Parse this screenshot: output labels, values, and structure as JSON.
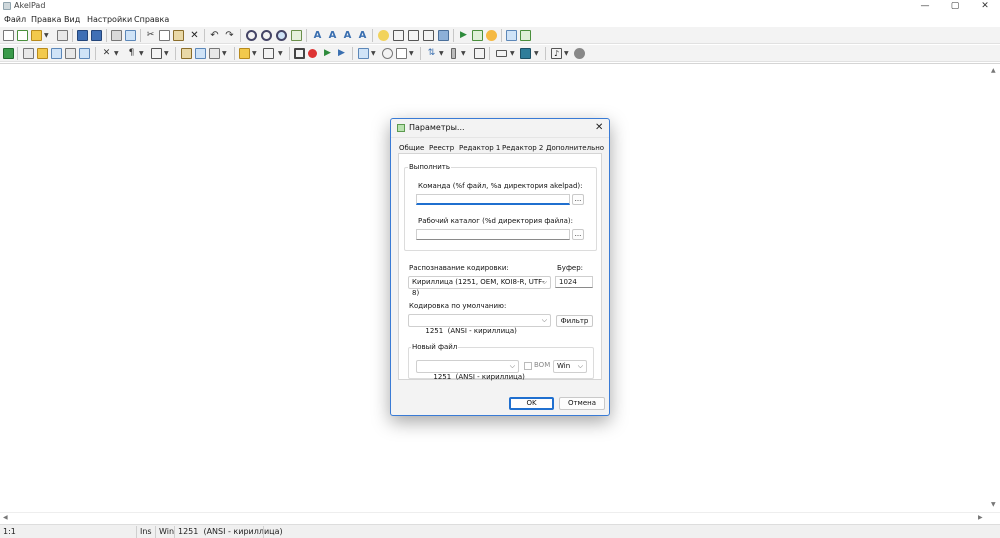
{
  "app": {
    "title": "AkelPad",
    "window_controls": {
      "minimize": "—",
      "maximize": "▢",
      "close": "✕"
    }
  },
  "menubar": {
    "items": [
      "Файл",
      "Правка",
      "Вид",
      "Настройки",
      "Справка"
    ]
  },
  "toolbars": {
    "row1_icons": [
      "new-file-icon",
      "new-window-icon",
      "open-icon",
      "open-dropdown-icon",
      "reopen-icon",
      "save-icon",
      "save-all-icon",
      "print-icon",
      "print-preview-icon",
      "cut-icon",
      "copy-icon",
      "paste-icon",
      "delete-icon",
      "undo-icon",
      "redo-icon",
      "find-icon",
      "find-next-icon",
      "replace-icon",
      "goto-icon",
      "font-a-icon",
      "font-b-icon",
      "font-c-icon",
      "font-d-icon",
      "pin-icon",
      "split-icon",
      "split-h-icon",
      "split-v-icon",
      "tools-icon",
      "play-icon",
      "record-icon",
      "smile-icon",
      "notes-icon",
      "edit-icon"
    ],
    "row2_icons": [
      "explorer-icon",
      "codefold-icon",
      "spell-icon",
      "hex-icon",
      "coder-icon",
      "scripts-icon",
      "format-icon",
      "view-icon",
      "layout-icon",
      "clipboard-icon",
      "macros-icon",
      "stop-icon",
      "record-macro-icon",
      "play-macro-icon",
      "run-macro-icon",
      "settings-icon",
      "sessions-icon",
      "window-icon",
      "sort-icon",
      "column-icon",
      "special-icon",
      "panel-icon",
      "log-icon",
      "music-icon",
      "plugin-icon"
    ]
  },
  "statusbar": {
    "position": "1:1",
    "insert_mode": "Ins",
    "newline": "Win",
    "encoding": "1251  (ANSI - кириллица)"
  },
  "dialog": {
    "title": "Параметры...",
    "close_icon": "✕",
    "tabs": [
      "Общие",
      "Реестр",
      "Редактор 1",
      "Редактор 2",
      "Дополнительно"
    ],
    "execute_group": {
      "title": "Выполнить",
      "command_label": "Команда (%f файл, %a директория akelpad):",
      "command_value": "",
      "browse_label": "...",
      "workdir_label": "Рабочий каталог (%d директория файла):",
      "workdir_value": ""
    },
    "detect_label": "Распознавание кодировки:",
    "detect_value": "Кириллица (1251, OEM, KOI8-R, UTF-8)",
    "buffer_label": "Буфер:",
    "buffer_value": "1024",
    "default_enc_label": "Кодировка по умолчанию:",
    "default_enc_value": "1251  (ANSI - кириллица)",
    "filter_button": "Фильтр",
    "new_file_group": {
      "title": "Новый файл",
      "encoding_value": "1251  (ANSI - кириллица)",
      "bom_label": "BOM",
      "newline_value": "Win"
    },
    "ok_button": "OK",
    "cancel_button": "Отмена"
  }
}
